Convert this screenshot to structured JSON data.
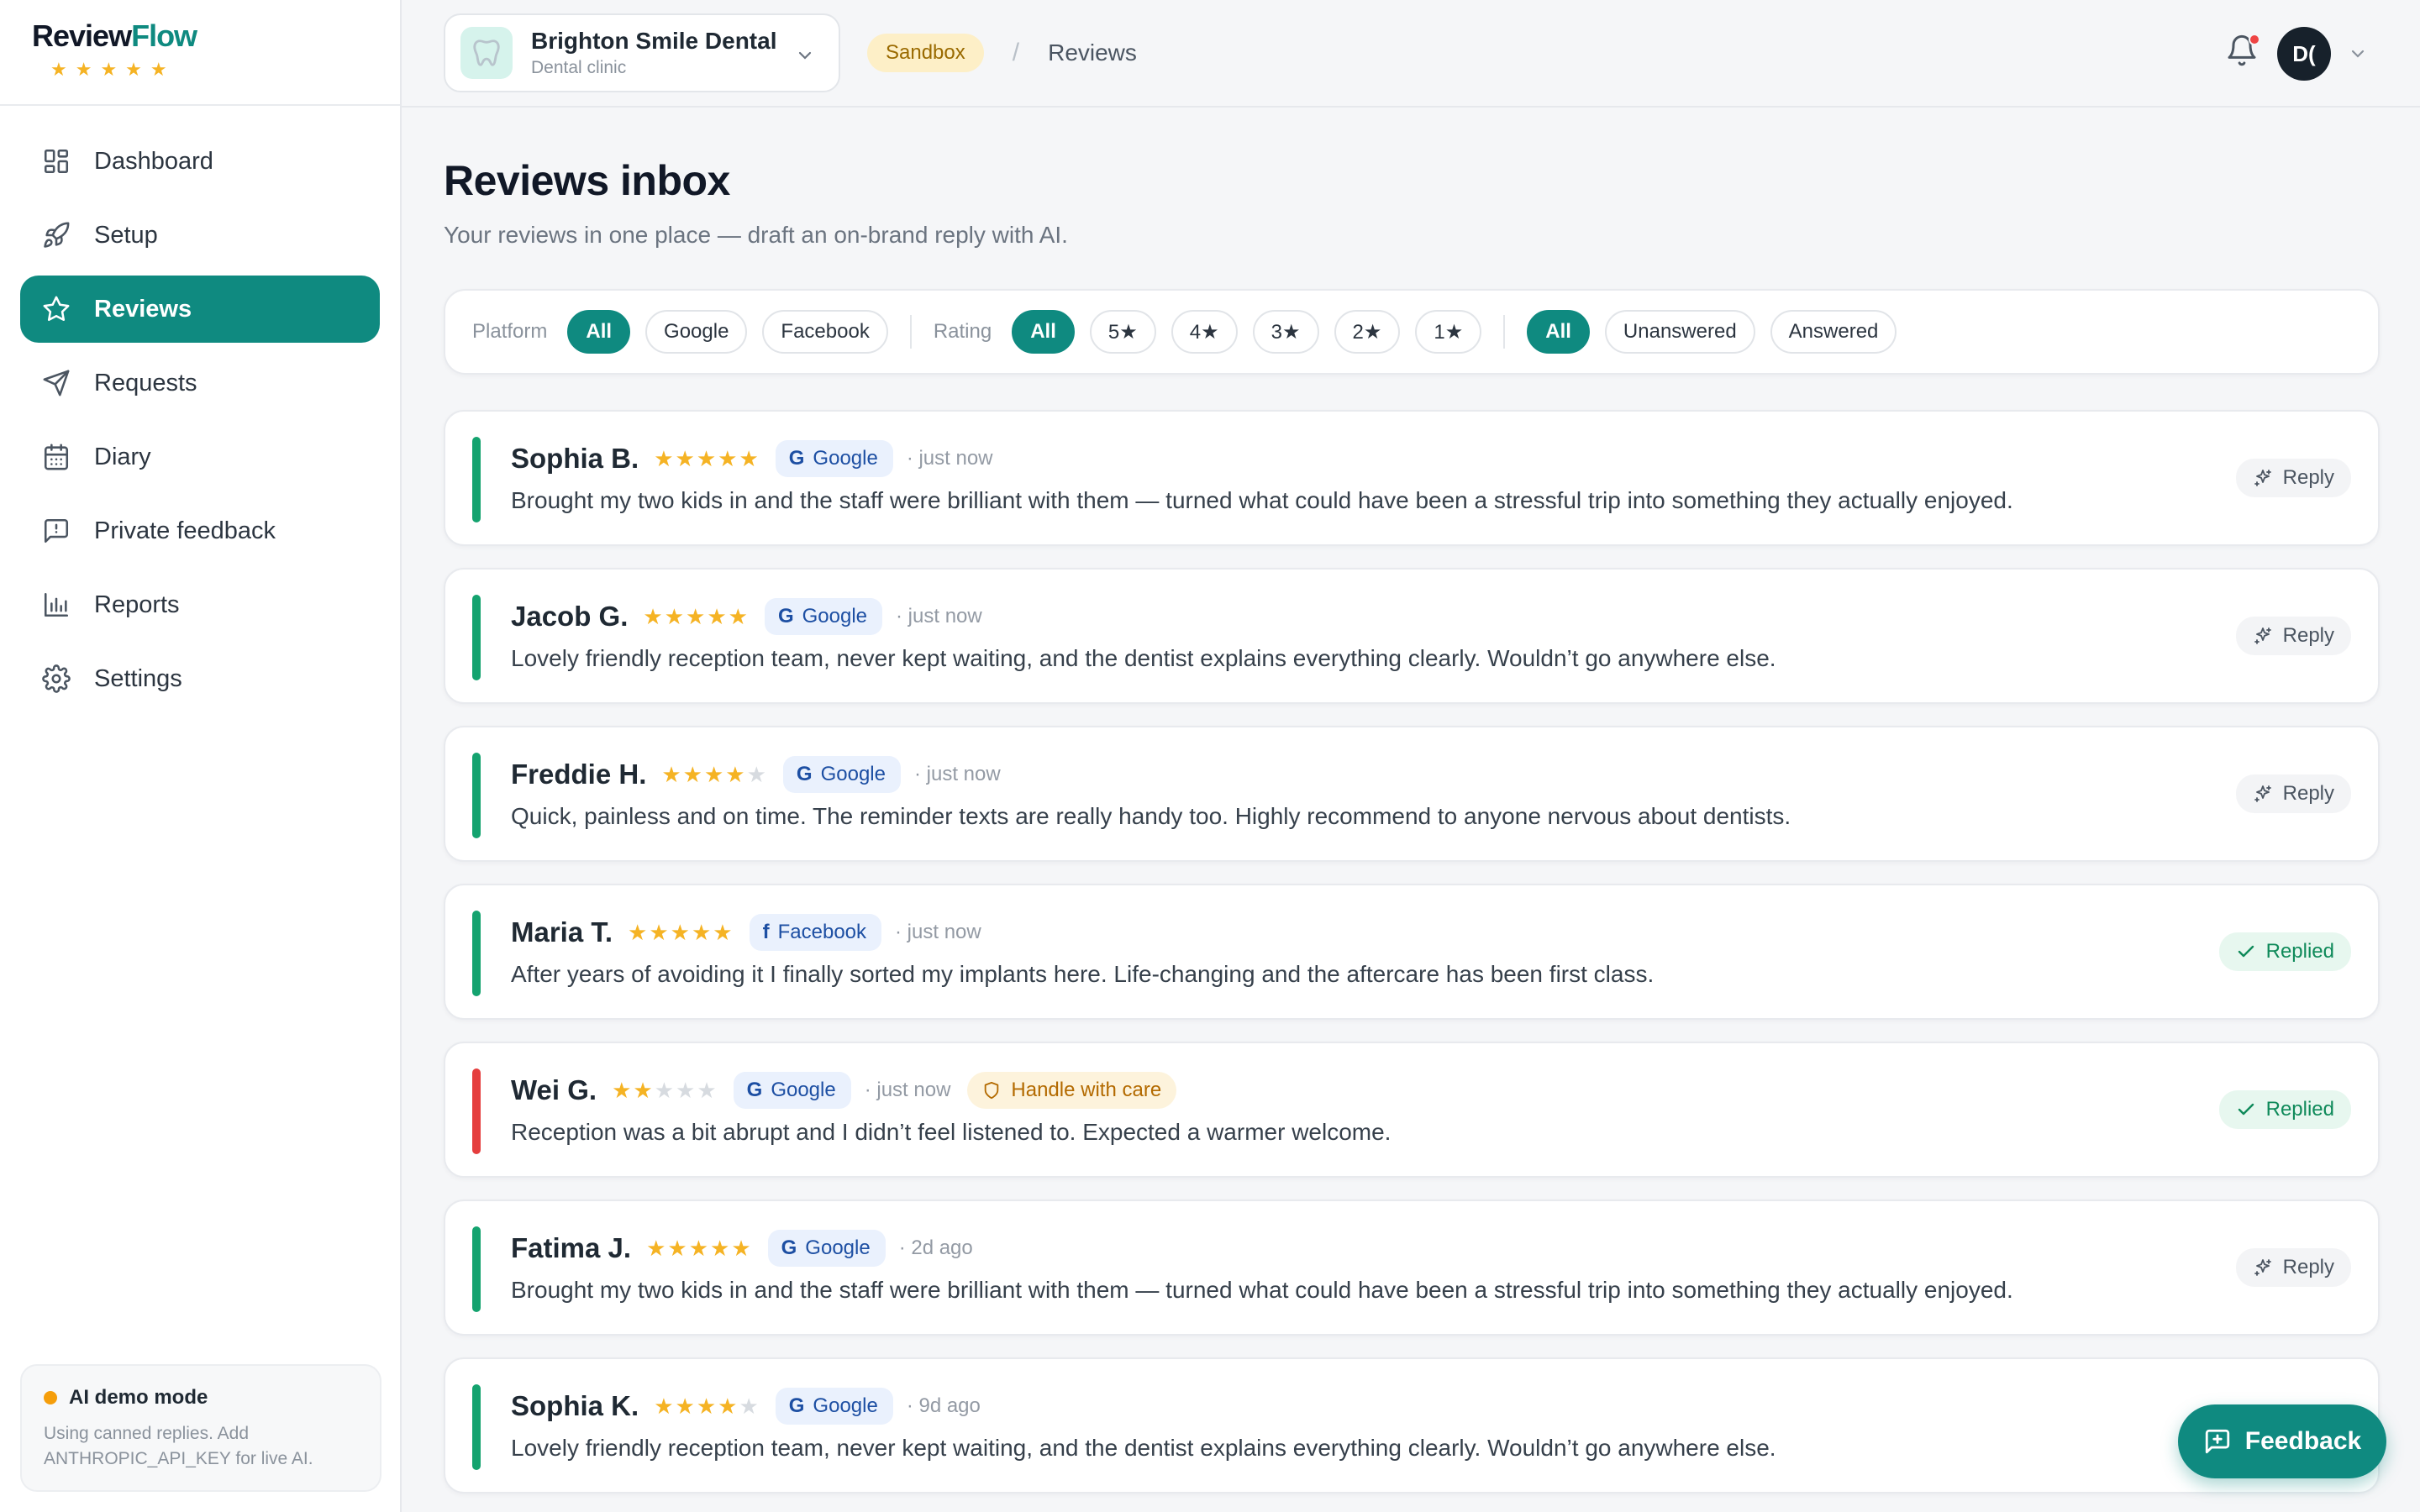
{
  "brand": {
    "name_part1": "Review",
    "name_part2": "Flow",
    "stars": "★★★★★"
  },
  "sidebar": {
    "items": [
      {
        "label": "Dashboard",
        "icon": "dashboard-icon"
      },
      {
        "label": "Setup",
        "icon": "rocket-icon"
      },
      {
        "label": "Reviews",
        "icon": "star-icon",
        "active": true
      },
      {
        "label": "Requests",
        "icon": "send-icon"
      },
      {
        "label": "Diary",
        "icon": "calendar-icon"
      },
      {
        "label": "Private feedback",
        "icon": "message-icon"
      },
      {
        "label": "Reports",
        "icon": "bar-chart-icon"
      },
      {
        "label": "Settings",
        "icon": "gear-icon"
      }
    ],
    "ai_card": {
      "title": "AI demo mode",
      "text": "Using canned replies. Add ANTHROPIC_API_KEY for live AI."
    }
  },
  "topbar": {
    "clinic_name": "Brighton Smile Dental",
    "clinic_type": "Dental clinic",
    "env_badge": "Sandbox",
    "crumb_sep": "/",
    "crumb": "Reviews",
    "avatar_initials": "D("
  },
  "page": {
    "title": "Reviews inbox",
    "subtitle": "Your reviews in one place — draft an on-brand reply with AI."
  },
  "filters": {
    "platform_label": "Platform",
    "platform": [
      "All",
      "Google",
      "Facebook"
    ],
    "rating_label": "Rating",
    "rating": [
      "All",
      "5★",
      "4★",
      "3★",
      "2★",
      "1★"
    ],
    "status": [
      "All",
      "Unanswered",
      "Answered"
    ]
  },
  "reviews": [
    {
      "name": "Sophia B.",
      "rating": 5,
      "platform": "Google",
      "platform_glyph": "G",
      "time": "· just now",
      "text": "Brought my two kids in and the staff were brilliant with them — turned what could have been a stressful trip into something they actually enjoyed.",
      "status": "reply",
      "action_label": "Reply"
    },
    {
      "name": "Jacob G.",
      "rating": 5,
      "platform": "Google",
      "platform_glyph": "G",
      "time": "· just now",
      "text": "Lovely friendly reception team, never kept waiting, and the dentist explains everything clearly. Wouldn’t go anywhere else.",
      "status": "reply",
      "action_label": "Reply"
    },
    {
      "name": "Freddie H.",
      "rating": 4,
      "platform": "Google",
      "platform_glyph": "G",
      "time": "· just now",
      "text": "Quick, painless and on time. The reminder texts are really handy too. Highly recommend to anyone nervous about dentists.",
      "status": "reply",
      "action_label": "Reply"
    },
    {
      "name": "Maria T.",
      "rating": 5,
      "platform": "Facebook",
      "platform_glyph": "f",
      "time": "· just now",
      "text": "After years of avoiding it I finally sorted my implants here. Life-changing and the aftercare has been first class.",
      "status": "replied",
      "action_label": "Replied"
    },
    {
      "name": "Wei G.",
      "rating": 2,
      "platform": "Google",
      "platform_glyph": "G",
      "time": "· just now",
      "care_label": "Handle with care",
      "text": "Reception was a bit abrupt and I didn’t feel listened to. Expected a warmer welcome.",
      "status": "replied",
      "action_label": "Replied",
      "negative": true
    },
    {
      "name": "Fatima J.",
      "rating": 5,
      "platform": "Google",
      "platform_glyph": "G",
      "time": "· 2d ago",
      "text": "Brought my two kids in and the staff were brilliant with them — turned what could have been a stressful trip into something they actually enjoyed.",
      "status": "reply",
      "action_label": "Reply"
    },
    {
      "name": "Sophia K.",
      "rating": 4,
      "platform": "Google",
      "platform_glyph": "G",
      "time": "· 9d ago",
      "text": "Lovely friendly reception team, never kept waiting, and the dentist explains everything clearly. Wouldn’t go anywhere else.",
      "status": "none",
      "action_label": ""
    }
  ],
  "feedback_button": {
    "label": "Feedback"
  },
  "colors": {
    "accent": "#0f8a80",
    "star": "#f5b324",
    "positive": "#14a36f",
    "negative": "#e53e3e"
  }
}
